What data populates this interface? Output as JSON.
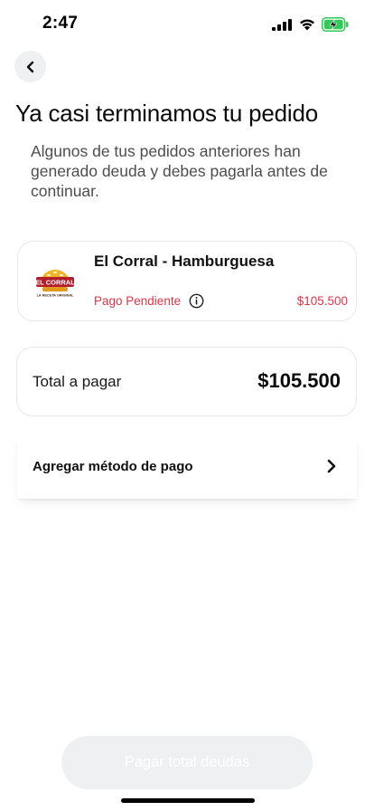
{
  "status_bar": {
    "time": "2:47"
  },
  "header": {
    "title": "Ya casi terminamos tu pedido",
    "subtitle": "Algunos de tus pedidos anteriores han generado deuda y debes pagarla antes de continuar."
  },
  "debt_item": {
    "store_name": "El Corral - Hamburguesa",
    "status": "Pago Pendiente",
    "amount": "$105.500",
    "logo_text": "EL CORRAL",
    "logo_tagline": "LA RECETA ORIGINAL"
  },
  "total": {
    "label": "Total a pagar",
    "value": "$105.500"
  },
  "payment_method": {
    "label": "Agregar método de pago"
  },
  "footer": {
    "button_label": "Pagar total deudas"
  },
  "colors": {
    "pending": "#d8374a",
    "battery": "#34c759",
    "button_bg": "#eef0f2"
  },
  "icons": [
    "chevron-left-icon",
    "info-icon",
    "chevron-right-icon",
    "signal-icon",
    "wifi-icon",
    "battery-charging-icon"
  ]
}
